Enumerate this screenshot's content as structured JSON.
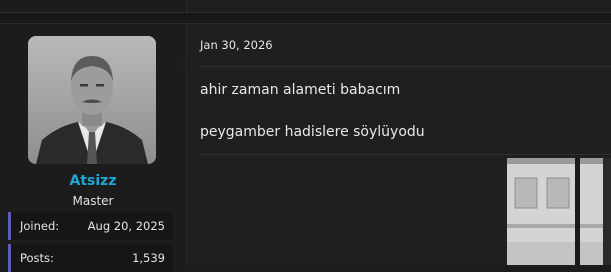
{
  "user": {
    "name": "Atsizz",
    "title": "Master",
    "stats": [
      {
        "label": "Joined:",
        "value": "Aug 20, 2025"
      },
      {
        "label": "Posts:",
        "value": "1,539"
      }
    ]
  },
  "post": {
    "date": "Jan 30, 2026",
    "lines": [
      "ahir zaman alameti babacım",
      "peygamber hadislere söylüyodu"
    ]
  },
  "colors": {
    "username": "#1ea7d7",
    "stat_accent": "#5a5fb5",
    "background": "#1c1c1c"
  }
}
